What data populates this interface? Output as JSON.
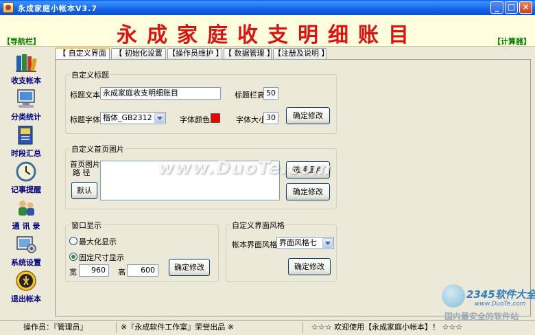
{
  "window": {
    "title": "永成家庭小帐本V3.7",
    "controls": {
      "minimize": "_",
      "maximize": "□",
      "close": "×"
    }
  },
  "banner": {
    "title": "永成家庭收支明细账目",
    "nav_label": "【导航栏】",
    "calc_label": "【计算器】"
  },
  "sidebar": {
    "items": [
      {
        "label": "收支帐本",
        "icon": "books-icon"
      },
      {
        "label": "分类统计",
        "icon": "computer-icon"
      },
      {
        "label": "时段汇总",
        "icon": "calendar-book-icon"
      },
      {
        "label": "记事提醒",
        "icon": "clock-icon"
      },
      {
        "label": "通 讯 录",
        "icon": "contacts-icon"
      },
      {
        "label": "系统设置",
        "icon": "settings-icon"
      },
      {
        "label": "退出帐本",
        "icon": "exit-icon"
      }
    ]
  },
  "tabs": [
    {
      "label": "【 自定义界面 】"
    },
    {
      "label": "【 初始化设置 】"
    },
    {
      "label": "【操作员维护 】"
    },
    {
      "label": "【 数据管理 】"
    },
    {
      "label": "【注册及说明 】"
    }
  ],
  "custom_title": {
    "legend": "自定义标题",
    "text_label": "标题文本",
    "text_value": "永成家庭收支明细账目",
    "height_label": "标题栏高",
    "height_value": "50",
    "font_label": "标题字体",
    "font_value": "楷体_GB2312",
    "color_label": "字体颜色",
    "color_value": "#EE0000",
    "size_label": "字体大小",
    "size_value": "30",
    "confirm_label": "确定修改"
  },
  "home_image": {
    "legend": "自定义首页图片",
    "path_label_1": "首页图片",
    "path_label_2": "路   径",
    "default_label": "默认",
    "select_label": "选择图片",
    "confirm_label": "确定修改"
  },
  "window_display": {
    "legend": "窗口显示",
    "maximize_label": "最大化显示",
    "fixed_label": "固定尺寸显示",
    "width_label": "宽",
    "width_value": "960",
    "height_label": "高",
    "height_value": "600",
    "confirm_label": "确定修改"
  },
  "ui_style": {
    "legend": "自定义界面风格",
    "style_label": "帐本界面风格",
    "style_value": "界面风格七",
    "confirm_label": "确定修改"
  },
  "watermark": "www.DuoTe.com",
  "corner_logo": {
    "brand": "2345软件大全",
    "url": "www.DuoTe.com",
    "sub": "国内最安全的软件站"
  },
  "statusbar": {
    "operator": "操作员：『管理员』",
    "studio": "※『永成软件工作室』荣誉出品 ※",
    "welcome": "☆☆☆   欢迎使用【永成家庭小帐本】！  ☆☆☆"
  }
}
